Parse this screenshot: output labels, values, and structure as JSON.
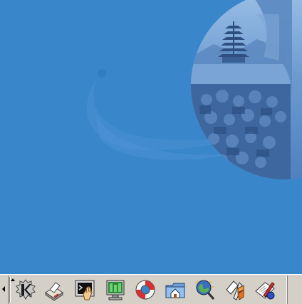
{
  "desktop": {
    "background_color": "#3a86cb"
  },
  "panel": {
    "background_color": "#d4d0c8",
    "launchers": [
      {
        "name": "kde-menu-icon"
      },
      {
        "name": "printer-icon"
      },
      {
        "name": "konsole-terminal-icon"
      },
      {
        "name": "control-center-icon"
      },
      {
        "name": "help-lifebuoy-icon"
      },
      {
        "name": "home-folder-icon"
      },
      {
        "name": "konqueror-web-browser-icon"
      },
      {
        "name": "kmail-icon"
      },
      {
        "name": "text-editor-icon"
      }
    ]
  }
}
